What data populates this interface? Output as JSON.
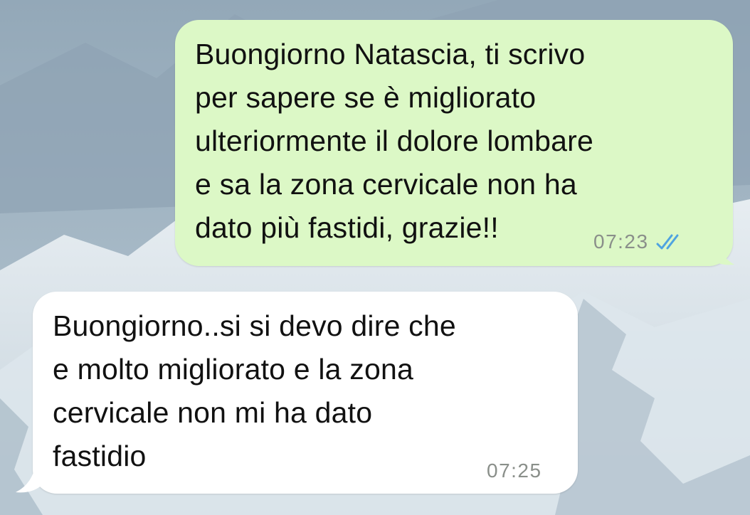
{
  "chat": {
    "messages": [
      {
        "direction": "outgoing",
        "text": "Buongiorno Natascia, ti scrivo\nper sapere se è migliorato\nulteriormente il dolore lombare\ne sa la zona cervicale non ha\ndato più fastidi, grazie!!",
        "time": "07:23",
        "status_icon": "double-check-read-icon"
      },
      {
        "direction": "incoming",
        "text": "Buongiorno..si si devo dire che\ne molto migliorato e la zona\ncervicale non mi ha dato\nfastidio",
        "time": "07:25"
      }
    ]
  },
  "colors": {
    "outgoing_bubble": "#dcf8c6",
    "incoming_bubble": "#ffffff",
    "read_ticks": "#4fa3e0",
    "timestamp": "#8a8f8a"
  }
}
